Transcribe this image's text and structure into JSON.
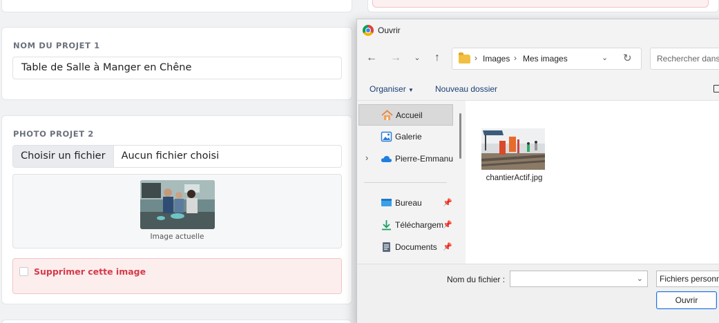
{
  "form": {
    "project_name": {
      "label": "NOM DU PROJET 1",
      "value": "Table de Salle à Manger en Chêne"
    },
    "photo": {
      "label": "PHOTO PROJET 2",
      "choose_button": "Choisir un fichier",
      "status": "Aucun fichier choisi",
      "current_caption": "Image actuelle",
      "delete_label": "Supprimer cette image",
      "delete_checked": false
    }
  },
  "dialog": {
    "title": "Ouvrir",
    "breadcrumb": [
      "Images",
      "Mes images"
    ],
    "search_placeholder": "Rechercher dans :",
    "toolbar": {
      "organize": "Organiser",
      "new_folder": "Nouveau dossier"
    },
    "nav_items": [
      {
        "label": "Accueil",
        "icon": "home-icon",
        "selected": true
      },
      {
        "label": "Galerie",
        "icon": "gallery-icon"
      },
      {
        "label": "Pierre-Emmanu",
        "icon": "cloud-icon",
        "expandable": true
      },
      {
        "label": "Bureau",
        "icon": "desktop-icon",
        "pinned": true
      },
      {
        "label": "Téléchargem",
        "icon": "download-icon",
        "pinned": true
      },
      {
        "label": "Documents",
        "icon": "documents-icon",
        "pinned": true
      }
    ],
    "files": [
      {
        "name": "chantierActif.jpg",
        "icon": "image-thumbnail"
      }
    ],
    "filename_label": "Nom du fichier :",
    "filename_value": "",
    "filetype": "Fichiers personn",
    "open_button": "Ouvrir"
  }
}
